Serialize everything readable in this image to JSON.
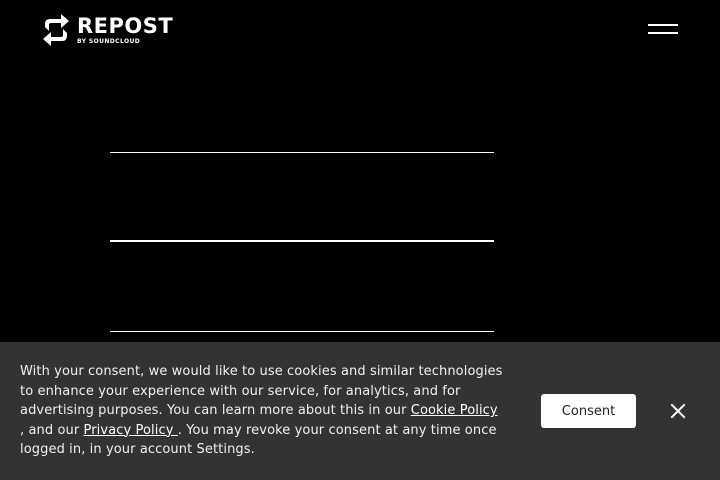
{
  "header": {
    "logo": {
      "word": "REPOST",
      "sub": "BY SOUNDCLOUD",
      "icon": "repost-icon"
    },
    "menu_icon": "hamburger-menu-icon"
  },
  "cookie_banner": {
    "text_1": "With your consent, we would like to use cookies and similar technologies to enhance your experience with our service, for analytics, and for advertising purposes. You can learn more about this in our ",
    "cookie_link": "Cookie Policy ",
    "text_2": ", and our ",
    "privacy_link": "Privacy Policy ",
    "text_3": ". You may revoke your consent at any time once logged in, in your account Settings.",
    "consent_label": "Consent",
    "close_icon": "close-icon"
  },
  "colors": {
    "background": "#000000",
    "banner": "#333333",
    "button": "#ffffff"
  }
}
